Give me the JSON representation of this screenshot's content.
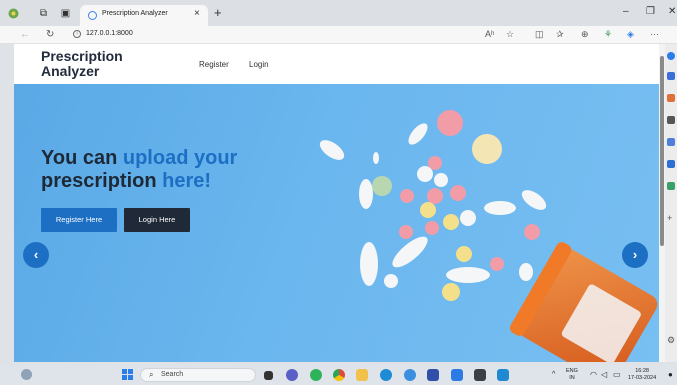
{
  "browser": {
    "tab_title": "Prescription Analyzer",
    "tab_close": "×",
    "new_tab": "+",
    "url": "127.0.0.1:8000",
    "reader_icon": "Aʰ",
    "minimize": "–",
    "maximize": "❐",
    "close": "✕"
  },
  "site": {
    "brand_line1": "Prescription",
    "brand_line2": "Analyzer",
    "nav": [
      "Register",
      "Login"
    ]
  },
  "hero": {
    "headline_1a": "You can ",
    "headline_1b": "upload your",
    "headline_2a": "prescription ",
    "headline_2b": "here!",
    "btn_register": "Register Here",
    "btn_login": "Login Here",
    "prev": "‹",
    "next": "›"
  },
  "taskbar": {
    "search_placeholder": "Search",
    "lang_1": "ENG",
    "lang_2": "IN",
    "time": "16:28",
    "date": "17-03-2024"
  },
  "colors": {
    "hero_bg": "#5aa9e6",
    "accent": "#1d6fc4",
    "dark": "#1f2937",
    "pill_bottle": "#e8641e"
  }
}
